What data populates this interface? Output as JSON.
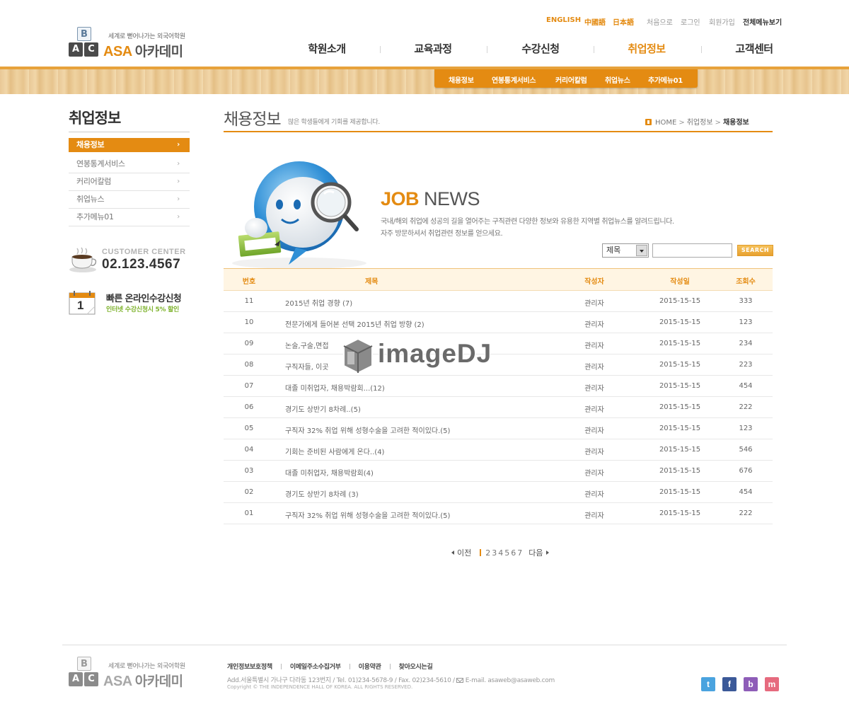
{
  "header": {
    "languages": [
      "ENGLISH",
      "中國語",
      "日本語"
    ],
    "utility_links": [
      "처음으로",
      "로그인",
      "회원가입"
    ],
    "sitemap": "전체메뉴보기",
    "logo": {
      "tagline": "세계로 뻗어나가는 외국어학원",
      "brand": "ASA",
      "brand_ko": "아카데미",
      "cube_letters": [
        "B",
        "A",
        "C"
      ]
    },
    "nav": [
      "학원소개",
      "교육과정",
      "수강신청",
      "취업정보",
      "고객센터"
    ],
    "nav_active": "취업정보",
    "subnav": [
      "채용정보",
      "연봉통계서비스",
      "커리어칼럼",
      "취업뉴스",
      "추가메뉴01"
    ]
  },
  "sidebar": {
    "title": "취업정보",
    "items": [
      {
        "label": "채용정보",
        "active": true
      },
      {
        "label": "연봉통계서비스",
        "active": false
      },
      {
        "label": "커리어칼럼",
        "active": false
      },
      {
        "label": "취업뉴스",
        "active": false
      },
      {
        "label": "추가메뉴01",
        "active": false
      }
    ],
    "arrow": "›",
    "customer_center": {
      "label": "CUSTOMER CENTER",
      "phone": "02.123.4567"
    },
    "online": {
      "title": "빠른 온라인수강신청",
      "subtitle": "인터넷 수강신청시 5% 할인",
      "calendar_day": "1"
    }
  },
  "content": {
    "title": "채용정보",
    "description": "많은 학생들에게 기회를 제공합니다.",
    "breadcrumb": [
      "HOME",
      "취업정보",
      "채용정보"
    ],
    "banner": {
      "title_bold": "JOB",
      "title_rest": "NEWS",
      "line1": "국내/해외 취업에 성공의 길을 열어주는 구직관련 다양한 정보와 유용한 지역별 취업뉴스를 알려드립니다.",
      "line2": "자주 방문하셔서 취업관련 정보를 얻으세요."
    },
    "search": {
      "select_value": "제목",
      "input_value": "",
      "button_label": "SEARCH"
    },
    "table": {
      "headers": [
        "번호",
        "제목",
        "작성자",
        "작성일",
        "조회수"
      ],
      "rows": [
        [
          "11",
          "2015년 취업 경향 (7)",
          "관리자",
          "2015-15-15",
          "333"
        ],
        [
          "10",
          "전문가에게 들어본 선택 2015년 취업 방향 (2)",
          "관리자",
          "2015-15-15",
          "123"
        ],
        [
          "09",
          "논술,구술,면접",
          "관리자",
          "2015-15-15",
          "234"
        ],
        [
          "08",
          "구직자들, 이곳",
          "관리자",
          "2015-15-15",
          "223"
        ],
        [
          "07",
          "대졸 미취업자, 채용박람회...(12)",
          "관리자",
          "2015-15-15",
          "454"
        ],
        [
          "06",
          "경기도 상반기 8차례..(5)",
          "관리자",
          "2015-15-15",
          "222"
        ],
        [
          "05",
          "구직자 32% 취업 위해 성형수술을 고려한 적이있다.(5)",
          "관리자",
          "2015-15-15",
          "123"
        ],
        [
          "04",
          "기회는 준비된 사람에게 온다..(4)",
          "관리자",
          "2015-15-15",
          "546"
        ],
        [
          "03",
          "대졸 미취업자, 채용박람회(4)",
          "관리자",
          "2015-15-15",
          "676"
        ],
        [
          "02",
          "경기도 상반기 8차례 (3)",
          "관리자",
          "2015-15-15",
          "454"
        ],
        [
          "01",
          "구직자 32% 취업 위해 성형수술을 고려한 적이있다.(5)",
          "관리자",
          "2015-15-15",
          "222"
        ]
      ]
    },
    "pagination": {
      "prev": "이전",
      "current": "1",
      "pages": [
        "2",
        "3",
        "4",
        "5",
        "6",
        "7"
      ],
      "next": "다음"
    },
    "watermark": "imageDJ"
  },
  "footer": {
    "links": [
      "개인정보보호정책",
      "이메일주소수집거부",
      "이용약관",
      "찾아오시는길"
    ],
    "address": "Add.서울특별시 가나구 다라동 123번지  /  Tel. 01)234-5678-9  /  Fax. 02)234-5610  /",
    "email": "E-mail. asaweb@asaweb.com",
    "copyright": "Copyright © THE INDEPENDENCE HALL OF KOREA. ALL RIGHTS RESERVED.",
    "sns": [
      {
        "name": "twitter-icon",
        "glyph": "t",
        "color": "#4aa3df"
      },
      {
        "name": "facebook-icon",
        "glyph": "f",
        "color": "#3b5998"
      },
      {
        "name": "blog-icon",
        "glyph": "b",
        "color": "#8e5db8"
      },
      {
        "name": "me2day-icon",
        "glyph": "m",
        "color": "#e66a7e"
      }
    ]
  },
  "colors": {
    "accent": "#e48b12",
    "accent_light": "#fff5e3",
    "green": "#7fb32e"
  }
}
